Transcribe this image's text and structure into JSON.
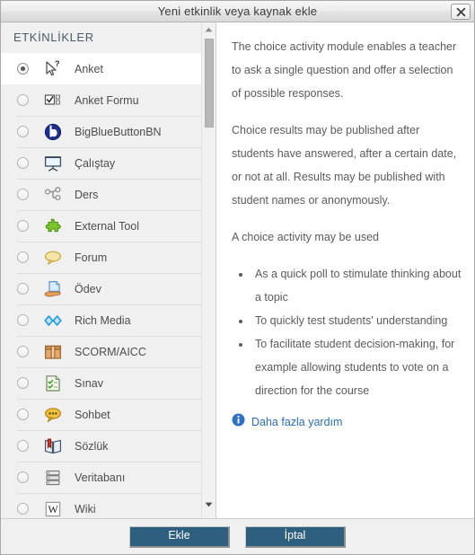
{
  "window": {
    "title": "Yeni etkinlik veya kaynak ekle",
    "close_icon": "close-icon"
  },
  "sidebar": {
    "heading": "ETKİNLİKLER",
    "selected_index": 0,
    "items": [
      {
        "label": "Anket",
        "icon": "cursor-question-icon",
        "selected": true
      },
      {
        "label": "Anket Formu",
        "icon": "checkbox-form-icon",
        "selected": false
      },
      {
        "label": "BigBlueButtonBN",
        "icon": "bigbluebutton-icon",
        "selected": false
      },
      {
        "label": "Çalıştay",
        "icon": "presentation-board-icon",
        "selected": false
      },
      {
        "label": "Ders",
        "icon": "node-tree-icon",
        "selected": false
      },
      {
        "label": "External Tool",
        "icon": "puzzle-piece-icon",
        "selected": false
      },
      {
        "label": "Forum",
        "icon": "speech-bubble-icon",
        "selected": false
      },
      {
        "label": "Ödev",
        "icon": "hand-document-icon",
        "selected": false
      },
      {
        "label": "Rich Media",
        "icon": "diamonds-icon",
        "selected": false
      },
      {
        "label": "SCORM/AICC",
        "icon": "package-box-icon",
        "selected": false
      },
      {
        "label": "Sınav",
        "icon": "checklist-icon",
        "selected": false
      },
      {
        "label": "Sohbet",
        "icon": "chat-bubble-icon",
        "selected": false
      },
      {
        "label": "Sözlük",
        "icon": "open-book-icon",
        "selected": false
      },
      {
        "label": "Veritabanı",
        "icon": "database-icon",
        "selected": false
      },
      {
        "label": "Wiki",
        "icon": "wikipedia-w-icon",
        "selected": false
      }
    ],
    "scrollbar": {
      "up_icon": "scroll-up-arrow-icon",
      "down_icon": "scroll-down-arrow-icon"
    }
  },
  "description": {
    "paragraphs": [
      "The choice activity module enables a teacher to ask a single question and offer a selection of possible responses.",
      "Choice results may be published after students have answered, after a certain date, or not at all. Results may be published with student names or anonymously.",
      "A choice activity may be used"
    ],
    "bullets": [
      "As a quick poll to stimulate thinking about a topic",
      "To quickly test students' understanding",
      "To facilitate student decision-making, for example allowing students to vote on a direction for the course"
    ],
    "help_link": "Daha fazla yardım",
    "help_icon": "info-icon"
  },
  "footer": {
    "submit_label": "Ekle",
    "cancel_label": "İptal"
  },
  "colors": {
    "button_bg": "#2e5f7e",
    "link": "#2a6ebb",
    "heading": "#4a5a6a",
    "panel_bg": "#f0f0f0"
  }
}
